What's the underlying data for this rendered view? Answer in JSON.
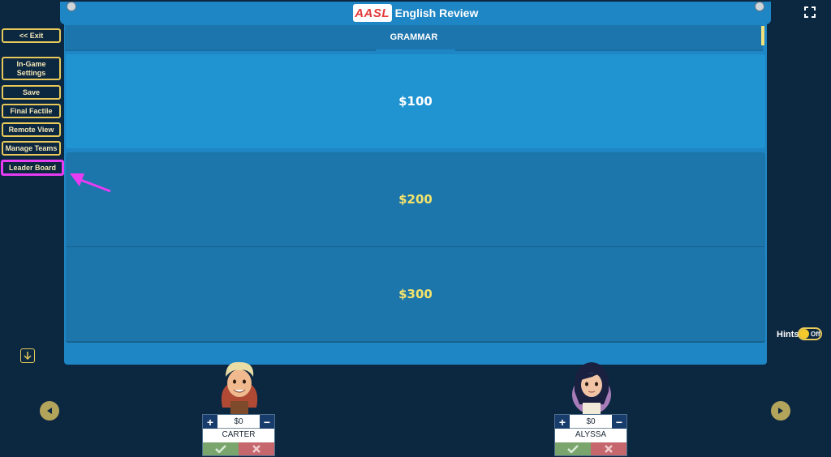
{
  "header": {
    "logo_text": "AASL",
    "title": "English Review"
  },
  "category": {
    "name": "GRAMMAR"
  },
  "tiles": [
    {
      "value": "$100",
      "color": "#ffffff"
    },
    {
      "value": "$200",
      "color": "#f3e36b"
    },
    {
      "value": "$300",
      "color": "#f3e36b"
    }
  ],
  "menu": {
    "exit": "<< Exit",
    "settings": "In-Game Settings",
    "save": "Save",
    "final": "Final Factile",
    "remote": "Remote View",
    "teams": "Manage Teams",
    "leader": "Leader Board"
  },
  "hints": {
    "label": "Hints",
    "state": "Off"
  },
  "players": [
    {
      "name": "CARTER",
      "score": "$0"
    },
    {
      "name": "ALYSSA",
      "score": "$0"
    }
  ],
  "colors": {
    "accent": "#e8c95a",
    "highlight": "#e83cf2",
    "board": "#1e86c5"
  }
}
